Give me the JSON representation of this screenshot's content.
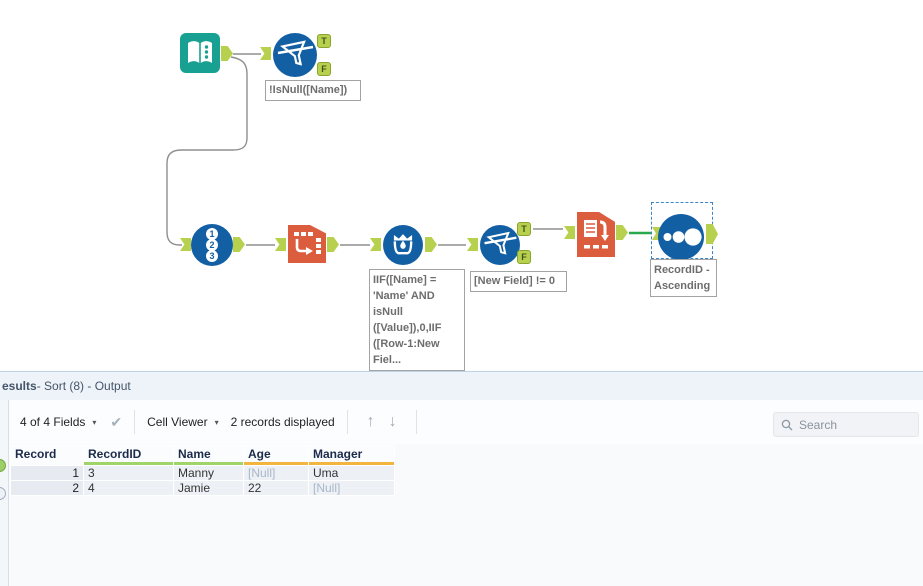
{
  "canvas": {
    "record_id_digits": [
      "1",
      "2",
      "3"
    ],
    "anchor_labels": {
      "t": "T",
      "f": "F"
    },
    "annotations": {
      "filter1": "!IsNull([Name])",
      "formula": "IIF([Name] =\n'Name' AND\nisNull\n([Value]),0,IIF\n([Row-1:New\nFiel...",
      "filter2": "[New Field] != 0",
      "browse": "RecordID -\nAscending"
    },
    "tools": [
      {
        "name": "input-data"
      },
      {
        "name": "filter-1"
      },
      {
        "name": "record-id"
      },
      {
        "name": "transpose"
      },
      {
        "name": "formula"
      },
      {
        "name": "filter-2"
      },
      {
        "name": "sort"
      },
      {
        "name": "browse-selected"
      }
    ]
  },
  "results_panel": {
    "title_bold": "esults",
    "title_rest": " - Sort (8) - Output",
    "toolbar": {
      "fields_dropdown": "4 of 4 Fields",
      "cell_viewer_dropdown": "Cell Viewer",
      "records_displayed": "2 records displayed",
      "up_arrow": "↑",
      "down_arrow": "↓",
      "check_icon": "✔",
      "caret": "▾",
      "search_placeholder": "Search"
    },
    "table": {
      "columns": [
        {
          "label": "Record",
          "underline": "none"
        },
        {
          "label": "RecordID",
          "underline": "green"
        },
        {
          "label": "Name",
          "underline": "green"
        },
        {
          "label": "Age",
          "underline": "orange"
        },
        {
          "label": "Manager",
          "underline": "orange"
        }
      ],
      "rows": [
        [
          "1",
          "3",
          "Manny",
          "[Null]",
          "Uma"
        ],
        [
          "2",
          "4",
          "Jamie",
          "22",
          "[Null]"
        ]
      ],
      "null_token": "[Null]"
    }
  },
  "colors": {
    "tool_blue": "#135fa4",
    "tool_teal": "#18a192",
    "tool_orange": "#dc5c3e",
    "anchor_green": "#b7d14e",
    "wire_green": "#2aa84e",
    "selection_blue": "#3a86c8",
    "underline_green": "#9fd468",
    "underline_orange": "#f2b53d",
    "null_text": "#a9b5c8"
  }
}
